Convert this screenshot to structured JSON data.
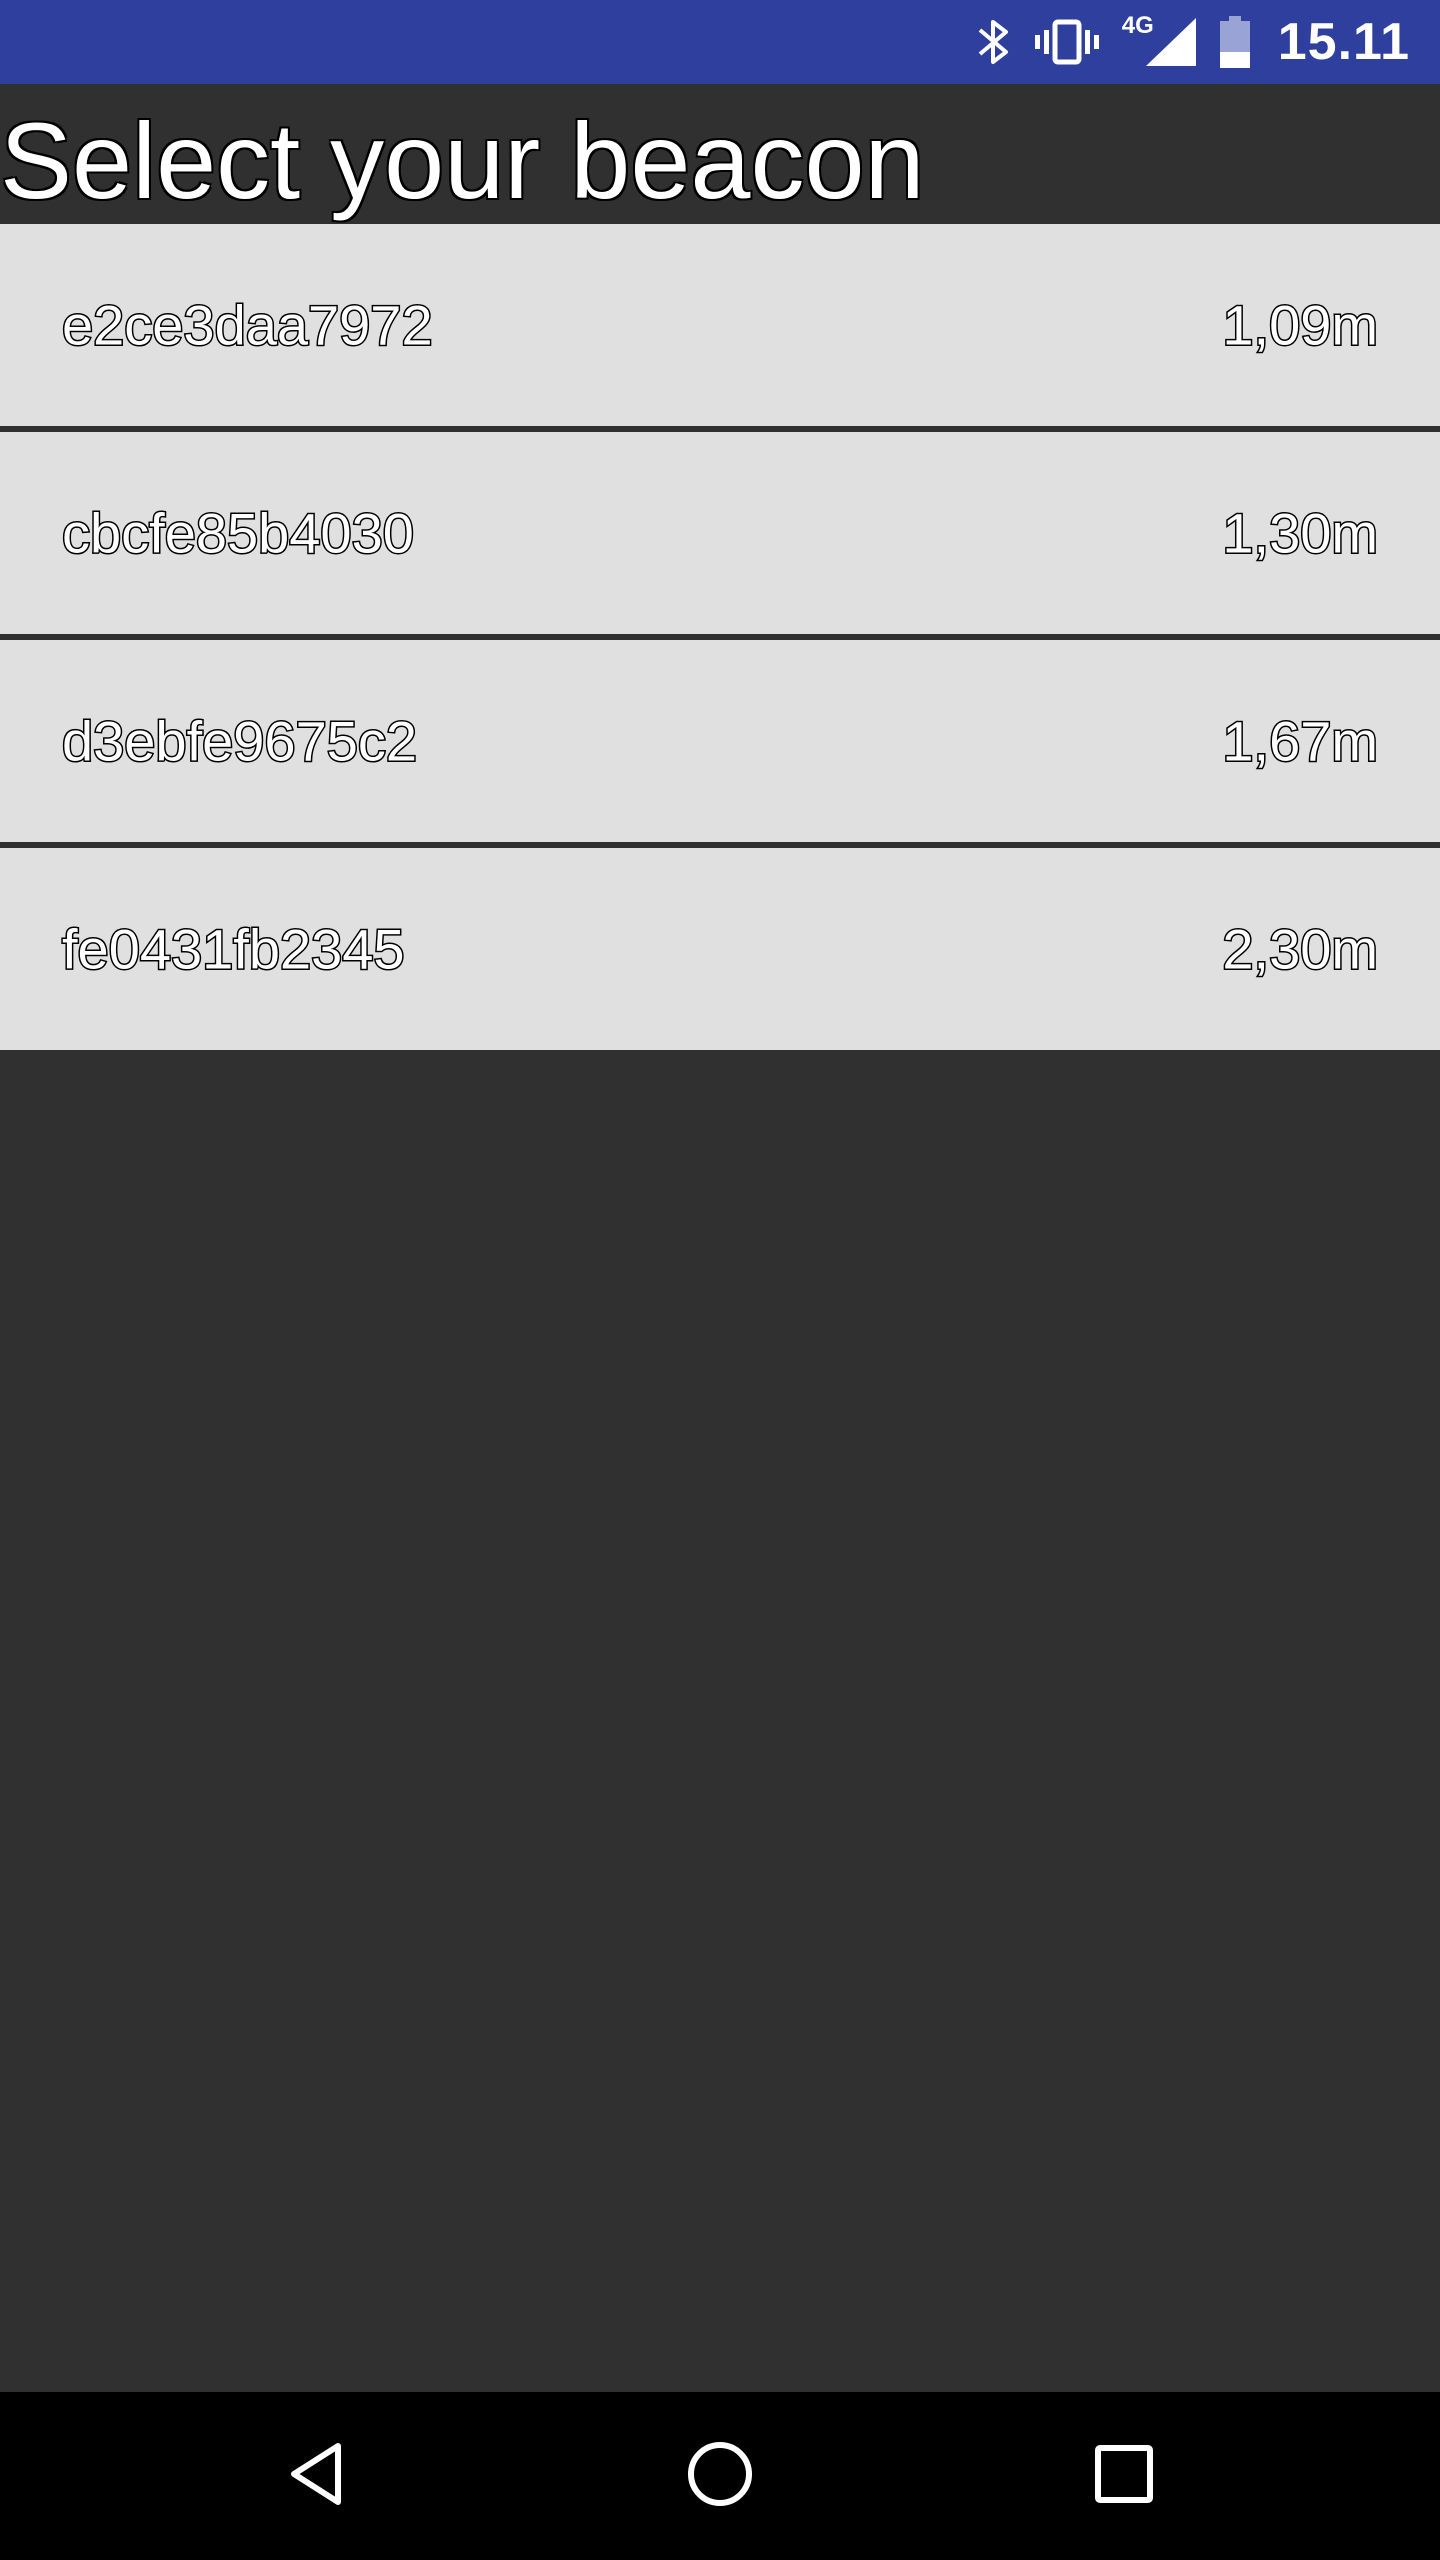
{
  "status_bar": {
    "bluetooth_icon": "bluetooth-icon",
    "vibrate_icon": "vibrate-icon",
    "network_label": "4G",
    "signal_icon": "cell-signal-icon",
    "battery_icon": "battery-icon",
    "time": "15.11",
    "background_color": "#2f3f9e"
  },
  "title": "Select your beacon",
  "beacons": [
    {
      "id": "e2ce3daa7972",
      "distance": "1,09m"
    },
    {
      "id": "cbcfe85b4030",
      "distance": "1,30m"
    },
    {
      "id": "d3ebfe9675c2",
      "distance": "1,67m"
    },
    {
      "id": "fe0431fb2345",
      "distance": "2,30m"
    }
  ],
  "nav_bar": {
    "back_icon": "back-triangle-icon",
    "home_icon": "home-circle-icon",
    "recents_icon": "recents-square-icon"
  },
  "colors": {
    "background": "#303030",
    "list_item": "#e0e0e0",
    "nav_bar": "#000000"
  }
}
